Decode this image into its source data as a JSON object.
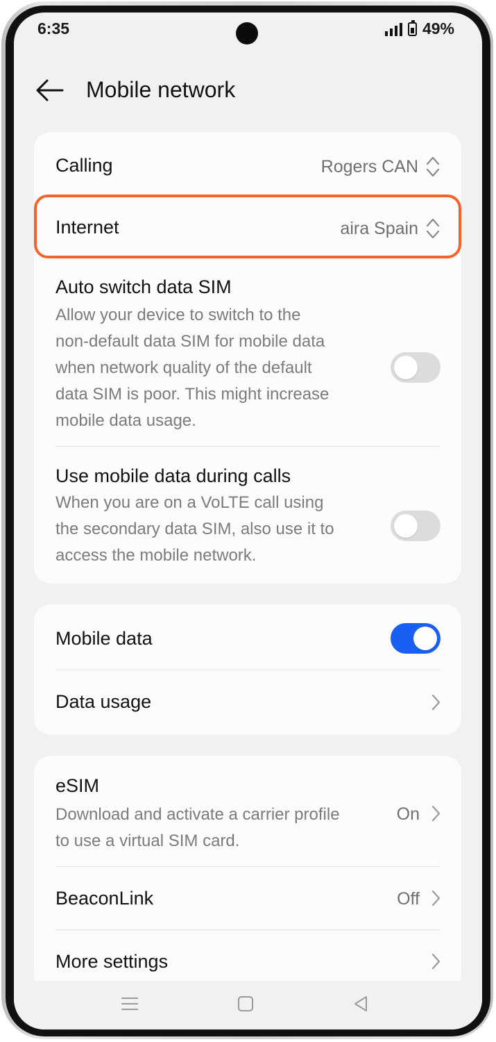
{
  "status_bar": {
    "time": "6:35",
    "battery": "49%"
  },
  "header": {
    "title": "Mobile network"
  },
  "sim_card": {
    "calling": {
      "label": "Calling",
      "value": "Rogers CAN"
    },
    "internet": {
      "label": "Internet",
      "value": "aira Spain"
    },
    "auto_switch": {
      "title": "Auto switch data SIM",
      "desc_lines": [
        "Allow your device to switch to the",
        "non-default data SIM for mobile data",
        "when network quality of the default",
        "data SIM is poor. This might increase",
        "mobile data usage."
      ],
      "enabled": false
    },
    "data_during_calls": {
      "title": "Use mobile data during calls",
      "desc_lines": [
        "When you are on a VoLTE call using",
        "the secondary data SIM, also use it to",
        "access the mobile network."
      ],
      "enabled": false
    }
  },
  "data_card": {
    "mobile_data": {
      "label": "Mobile data",
      "enabled": true
    },
    "data_usage": {
      "label": "Data usage"
    }
  },
  "more_card": {
    "esim": {
      "title": "eSIM",
      "desc_lines": [
        "Download and activate a carrier profile",
        "to use a virtual SIM card."
      ],
      "value": "On"
    },
    "beaconlink": {
      "label": "BeaconLink",
      "value": "Off"
    },
    "more_settings": {
      "label": "More settings"
    }
  },
  "colors": {
    "accent": "#1a5ff2",
    "highlight": "#f2642c"
  },
  "icons": [
    "back-arrow-icon",
    "updown-icon",
    "chevron-right-icon",
    "menu-icon",
    "home-icon",
    "back-triangle-icon"
  ]
}
